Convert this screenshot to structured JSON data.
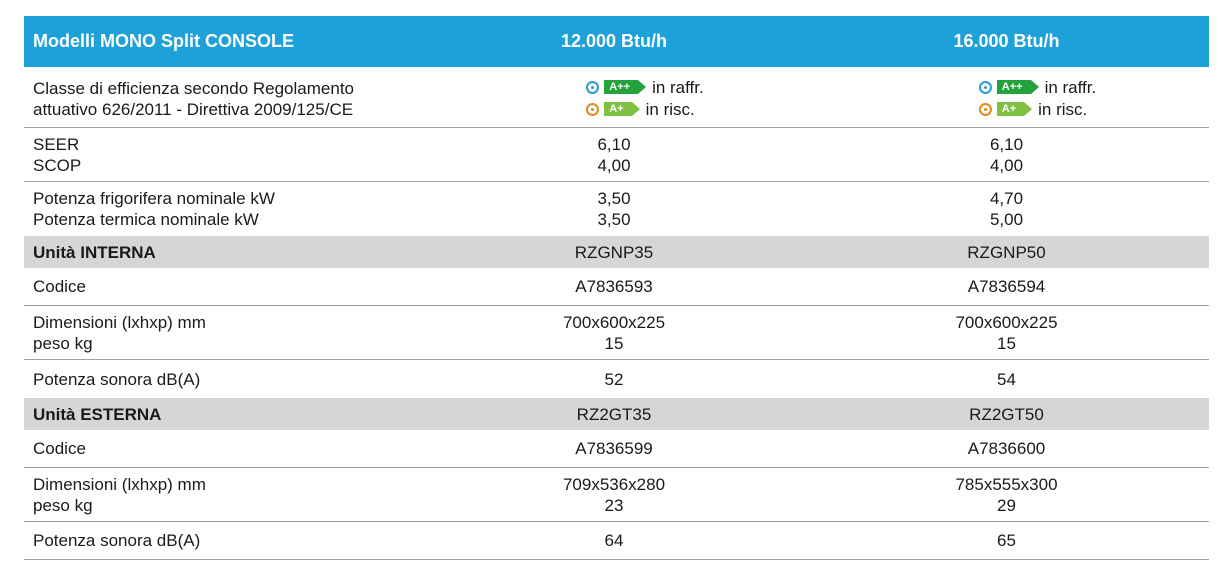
{
  "header": {
    "model_label": "Modelli MONO Split CONSOLE",
    "col1": "12.000 Btu/h",
    "col2": "16.000 Btu/h"
  },
  "efficiency": {
    "label_line1": "Classe di efficienza secondo Regolamento",
    "label_line2": "attuativo 626/2011 - Direttiva 2009/125/CE",
    "col1": {
      "cool_badge": "A++",
      "cool_text": "in raffr.",
      "heat_badge": "A+",
      "heat_text": "in risc."
    },
    "col2": {
      "cool_badge": "A++",
      "cool_text": "in raffr.",
      "heat_badge": "A+",
      "heat_text": "in risc."
    }
  },
  "seer_scop": {
    "label1": "SEER",
    "label2": "SCOP",
    "col1": [
      "6,10",
      "4,00"
    ],
    "col2": [
      "6,10",
      "4,00"
    ]
  },
  "power": {
    "label1": "Potenza frigorifera nominale kW",
    "label2": "Potenza termica nominale kW",
    "col1": [
      "3,50",
      "3,50"
    ],
    "col2": [
      "4,70",
      "5,00"
    ]
  },
  "indoor": {
    "title": "Unità INTERNA",
    "model": [
      "RZGNP35",
      "RZGNP50"
    ],
    "code_label": "Codice",
    "code": [
      "A7836593",
      "A7836594"
    ],
    "dim_label1": "Dimensioni (lxhxp) mm",
    "dim_label2": "peso kg",
    "dim": [
      "700x600x225",
      "700x600x225"
    ],
    "weight": [
      "15",
      "15"
    ],
    "sound_label": "Potenza sonora dB(A)",
    "sound": [
      "52",
      "54"
    ]
  },
  "outdoor": {
    "title": "Unità ESTERNA",
    "model": [
      "RZ2GT35",
      "RZ2GT50"
    ],
    "code_label": "Codice",
    "code": [
      "A7836599",
      "A7836600"
    ],
    "dim_label1": "Dimensioni (lxhxp) mm",
    "dim_label2": "peso kg",
    "dim": [
      "709x536x280",
      "785x555x300"
    ],
    "weight": [
      "23",
      "29"
    ],
    "sound_label": "Potenza sonora dB(A)",
    "sound": [
      "64",
      "65"
    ]
  },
  "colors": {
    "header_bg": "#1ea0d8",
    "section_bg": "#d6d6d6",
    "badge_app": "#23a33a",
    "badge_ap": "#7fc241"
  }
}
